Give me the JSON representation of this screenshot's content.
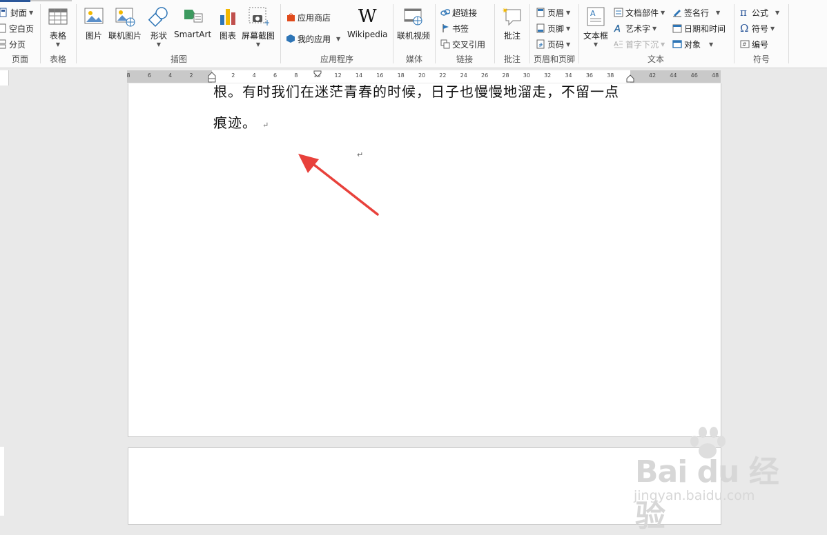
{
  "ribbon": {
    "pages_group": {
      "label": "页面",
      "cover": "封面",
      "blank_page": "空白页",
      "page_break": "分页"
    },
    "table_group": {
      "label": "表格",
      "table": "表格"
    },
    "illustrations_group": {
      "label": "插图",
      "picture": "图片",
      "online_picture": "联机图片",
      "shapes": "形状",
      "smartart": "SmartArt",
      "chart": "图表",
      "screenshot": "屏幕截图"
    },
    "apps_group": {
      "label": "应用程序",
      "store": "应用商店",
      "my_apps": "我的应用",
      "wikipedia": "Wikipedia",
      "wikipedia_glyph": "W"
    },
    "media_group": {
      "label": "媒体",
      "online_video": "联机视频"
    },
    "links_group": {
      "label": "链接",
      "hyperlink": "超链接",
      "bookmark": "书签",
      "cross_reference": "交叉引用"
    },
    "comments_group": {
      "label": "批注",
      "comment": "批注"
    },
    "header_footer_group": {
      "label": "页眉和页脚",
      "header": "页眉",
      "footer": "页脚",
      "page_number": "页码"
    },
    "text_group": {
      "label": "文本",
      "text_box": "文本框",
      "quick_parts": "文档部件",
      "wordart": "艺术字",
      "drop_cap": "首字下沉",
      "signature_line": "签名行",
      "date_time": "日期和时间",
      "object": "对象"
    },
    "symbols_group": {
      "label": "符号",
      "equation": "公式",
      "symbol": "符号",
      "number": "编号"
    }
  },
  "ruler": {
    "ticks": [
      "8",
      "6",
      "4",
      "2",
      "",
      "2",
      "4",
      "6",
      "8",
      "10",
      "12",
      "14",
      "16",
      "18",
      "20",
      "22",
      "24",
      "26",
      "28",
      "30",
      "32",
      "34",
      "36",
      "38",
      "",
      "42",
      "44",
      "46",
      "48"
    ]
  },
  "document": {
    "line1": "根。有时我们在迷茫青春的时候，日子也慢慢地溜走，不留一点",
    "line2": "痕迹。",
    "paragraph_mark": "↵"
  },
  "colors": {
    "accent": "#2b579a",
    "arrow": "#e8413b"
  },
  "watermark": {
    "logo": "Bai du 经验",
    "url": "jingyan.baidu.com"
  }
}
